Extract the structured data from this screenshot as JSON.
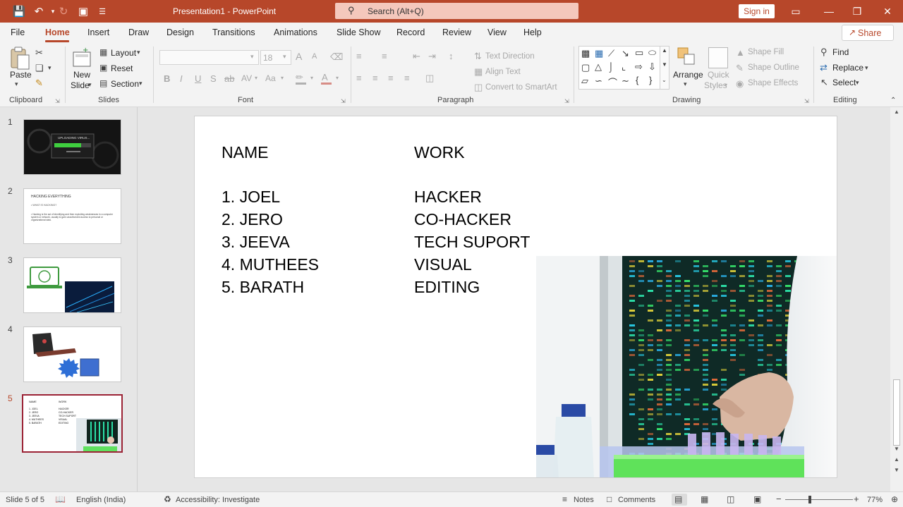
{
  "titlebar": {
    "title": "Presentation1  -  PowerPoint",
    "search_placeholder": "Search (Alt+Q)",
    "signin_label": "Sign in",
    "accent": "#b7472a"
  },
  "menu": {
    "file": "File",
    "home": "Home",
    "insert": "Insert",
    "draw": "Draw",
    "design": "Design",
    "transitions": "Transitions",
    "animations": "Animations",
    "slideshow": "Slide Show",
    "record": "Record",
    "review": "Review",
    "view": "View",
    "help": "Help",
    "share": "Share"
  },
  "ribbon": {
    "clipboard": {
      "label": "Clipboard",
      "paste": "Paste"
    },
    "slides": {
      "label": "Slides",
      "new_slide_1": "New",
      "new_slide_2": "Slide",
      "layout": "Layout",
      "reset": "Reset",
      "section": "Section"
    },
    "font": {
      "label": "Font",
      "size": "18",
      "bold": "B",
      "italic": "I",
      "underline": "U",
      "shadow": "S",
      "strike": "ab",
      "spacing": "AV",
      "case": "Aa",
      "grow": "A",
      "shrink": "A"
    },
    "paragraph": {
      "label": "Paragraph",
      "text_direction": "Text Direction",
      "align_text": "Align Text",
      "convert_smartart": "Convert to SmartArt"
    },
    "drawing": {
      "label": "Drawing",
      "arrange": "Arrange",
      "quick_styles_1": "Quick",
      "quick_styles_2": "Styles",
      "shape_fill": "Shape Fill",
      "shape_outline": "Shape Outline",
      "shape_effects": "Shape Effects"
    },
    "editing": {
      "label": "Editing",
      "find": "Find",
      "replace": "Replace",
      "select": "Select"
    }
  },
  "slides_panel": {
    "numbers": [
      "1",
      "2",
      "3",
      "4",
      "5"
    ],
    "thumb1_title": "UPLOADING VIRUS...",
    "thumb2_title": "HACKING EVERYTHING",
    "thumb2_bullet1": "• WHAT IS HACKING?",
    "thumb2_bullet2": "• Hacking is the act of identifying and then exploiting weaknesses in a computer system or network, usually to gain unauthorized access to personal or organizational data."
  },
  "slide": {
    "col1_header": "NAME",
    "col2_header": "WORK",
    "names": [
      "1. JOEL",
      "2. JERO",
      "3. JEEVA",
      "4. MUTHEES",
      "5. BARATH"
    ],
    "works": [
      "HACKER",
      "CO-HACKER",
      "TECH SUPORT",
      "VISUAL",
      "EDITING"
    ]
  },
  "status": {
    "slide_count": "Slide 5 of 5",
    "language": "English (India)",
    "accessibility": "Accessibility: Investigate",
    "notes": "Notes",
    "comments": "Comments",
    "zoom": "77%"
  }
}
